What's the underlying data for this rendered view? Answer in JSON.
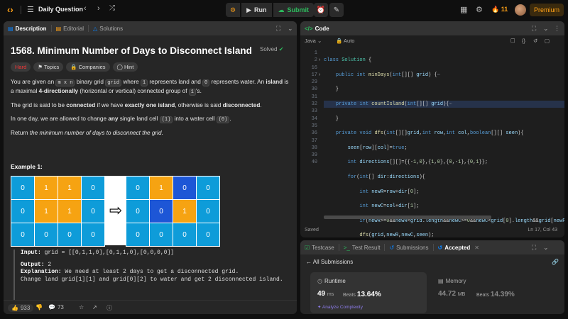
{
  "topbar": {
    "logo": "‹›",
    "title": "Daily Question",
    "run_label": "Run",
    "submit_label": "Submit",
    "streak": "11",
    "premium_label": "Premium"
  },
  "left_panel": {
    "tabs": [
      {
        "label": "Description"
      },
      {
        "label": "Editorial"
      },
      {
        "label": "Solutions"
      }
    ],
    "title": "1568. Minimum Number of Days to Disconnect Island",
    "solved_label": "Solved",
    "tags": [
      "Hard",
      "Topics",
      "Companies",
      "Hint"
    ],
    "desc": {
      "p1_a": "You are given an ",
      "p1_code1": "m x n",
      "p1_b": " binary grid ",
      "p1_code2": "grid",
      "p1_c": " where ",
      "p1_code3": "1",
      "p1_d": " represents land and ",
      "p1_code4": "0",
      "p1_e": " represents water. An ",
      "p1_island": "island",
      "p1_f": " is a maximal ",
      "p1_bold": "4-directionally",
      "p1_g": " (horizontal or vertical) connected group of ",
      "p1_code5": "1",
      "p1_h": "'s.",
      "p2_a": "The grid is said to be ",
      "p2_b1": "connected",
      "p2_b": " if we have ",
      "p2_b2": "exactly one island",
      "p2_c": ", otherwise is said ",
      "p2_b3": "disconnected",
      "p2_d": ".",
      "p3_a": "In one day, we are allowed to change ",
      "p3_b1": "any",
      "p3_b": " single land cell ",
      "p3_code1": "(1)",
      "p3_c": " into a water cell ",
      "p3_code2": "(0)",
      "p3_d": ".",
      "p4_a": "Return ",
      "p4_i": "the minimum number of days to disconnect the grid",
      "p4_b": "."
    },
    "example_title": "Example 1:",
    "grid_before": [
      [
        0,
        1,
        1,
        0
      ],
      [
        0,
        1,
        1,
        0
      ],
      [
        0,
        0,
        0,
        0
      ]
    ],
    "grid_after": [
      [
        0,
        1,
        0,
        0
      ],
      [
        0,
        0,
        1,
        0
      ],
      [
        0,
        0,
        0,
        0
      ]
    ],
    "example": {
      "input_label": "Input:",
      "input_value": "grid = [[0,1,1,0],[0,1,1,0],[0,0,0,0]]",
      "output_label": "Output:",
      "output_value": "2",
      "explanation_label": "Explanation:",
      "explanation_l1": "We need at least 2 days to get a disconnected grid.",
      "explanation_l2": "Change land grid[1][1] and grid[0][2] to water and get 2 disconnected island."
    },
    "footer": {
      "likes": "933",
      "comments": "73"
    }
  },
  "code_panel": {
    "title": "Code",
    "language": "Java",
    "mode": "Auto",
    "saved_label": "Saved",
    "cursor": "Ln 17, Col 43",
    "line_numbers": [
      "1",
      "2",
      "16",
      "17",
      "29",
      "30",
      "31",
      "32",
      "33",
      "34",
      "35",
      "36",
      "37",
      "38",
      "39",
      "40"
    ]
  },
  "result_panel": {
    "tabs": [
      "Testcase",
      "Test Result",
      "Submissions",
      "Accepted"
    ],
    "all_submissions": "All Submissions",
    "runtime_label": "Runtime",
    "runtime_value": "49",
    "runtime_unit": "ms",
    "runtime_beats_label": "Beats",
    "runtime_beats": "13.64%",
    "analyze_label": "Analyze Complexity",
    "memory_label": "Memory",
    "memory_value": "44.72",
    "memory_unit": "MB",
    "memory_beats_label": "Beats",
    "memory_beats": "14.39%"
  },
  "colors": {
    "accent": "#ffa116",
    "hard": "#f63737",
    "accepted": "#2cbb5d",
    "water": "#0e9cd9",
    "land": "#f6a312",
    "removed": "#1d56d6"
  }
}
